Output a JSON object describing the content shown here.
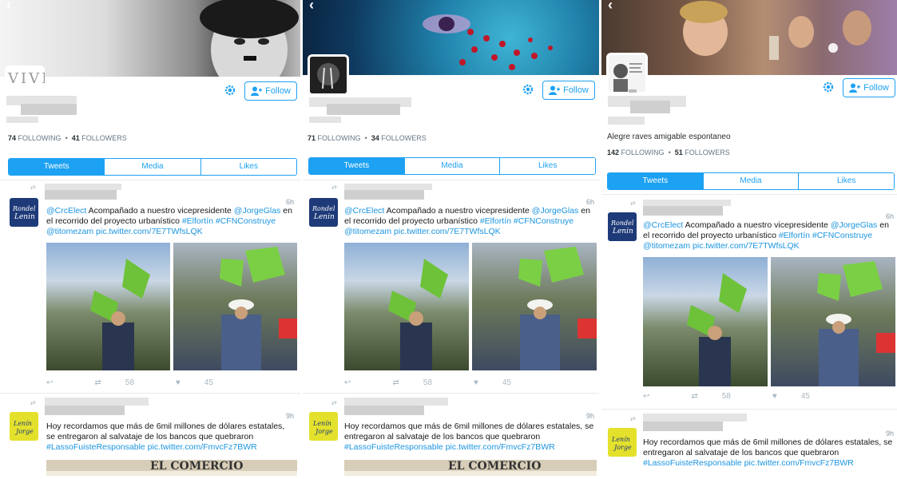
{
  "colors": {
    "accent": "#1da1f2",
    "link": "#1b95e0"
  },
  "profiles": [
    {
      "banner_text": "VIVE",
      "follow_label": "Follow",
      "following_count": "74",
      "following_label": "FOLLOWING",
      "followers_count": "41",
      "followers_label": "FOLLOWERS",
      "bio": "",
      "tabs": [
        "Tweets",
        "Media",
        "Likes"
      ]
    },
    {
      "banner_text": "",
      "follow_label": "Follow",
      "following_count": "71",
      "following_label": "FOLLOWING",
      "followers_count": "34",
      "followers_label": "FOLLOWERS",
      "bio": "",
      "tabs": [
        "Tweets",
        "Media",
        "Likes"
      ]
    },
    {
      "banner_text": "",
      "follow_label": "Follow",
      "following_count": "142",
      "following_label": "FOLLOWING",
      "followers_count": "51",
      "followers_label": "FOLLOWERS",
      "bio": "Alegre raves amigable espontaneo",
      "tabs": [
        "Tweets",
        "Media",
        "Likes"
      ]
    }
  ],
  "tweet1": {
    "time": "6h",
    "mention1": "@CrcElect",
    "text1": " Acompañado a nuestro vicepresidente ",
    "mention2": "@JorgeGlas",
    "text2": " en el recorrido del proyecto urbanístico ",
    "hashtags": "#Elfortín #CFNConstruye",
    "mention3": "@titomezam",
    "link": "pic.twitter.com/7E7TWfsLQK",
    "retweets": "58",
    "likes": "45"
  },
  "tweet2": {
    "time": "9h",
    "text": "Hoy recordamos que más de 6mil millones de dólares estatales, se entregaron al salvataje de los bancos que quebraron",
    "hashtag": "#LassoFuisteResponsable",
    "link": "pic.twitter.com/FmvcFz7BWR",
    "newspaper_masthead": "EL COMERCIO"
  },
  "icons": [
    "back-icon",
    "gear-icon",
    "add-user-icon",
    "retweet-icon",
    "reply-icon",
    "heart-icon"
  ]
}
